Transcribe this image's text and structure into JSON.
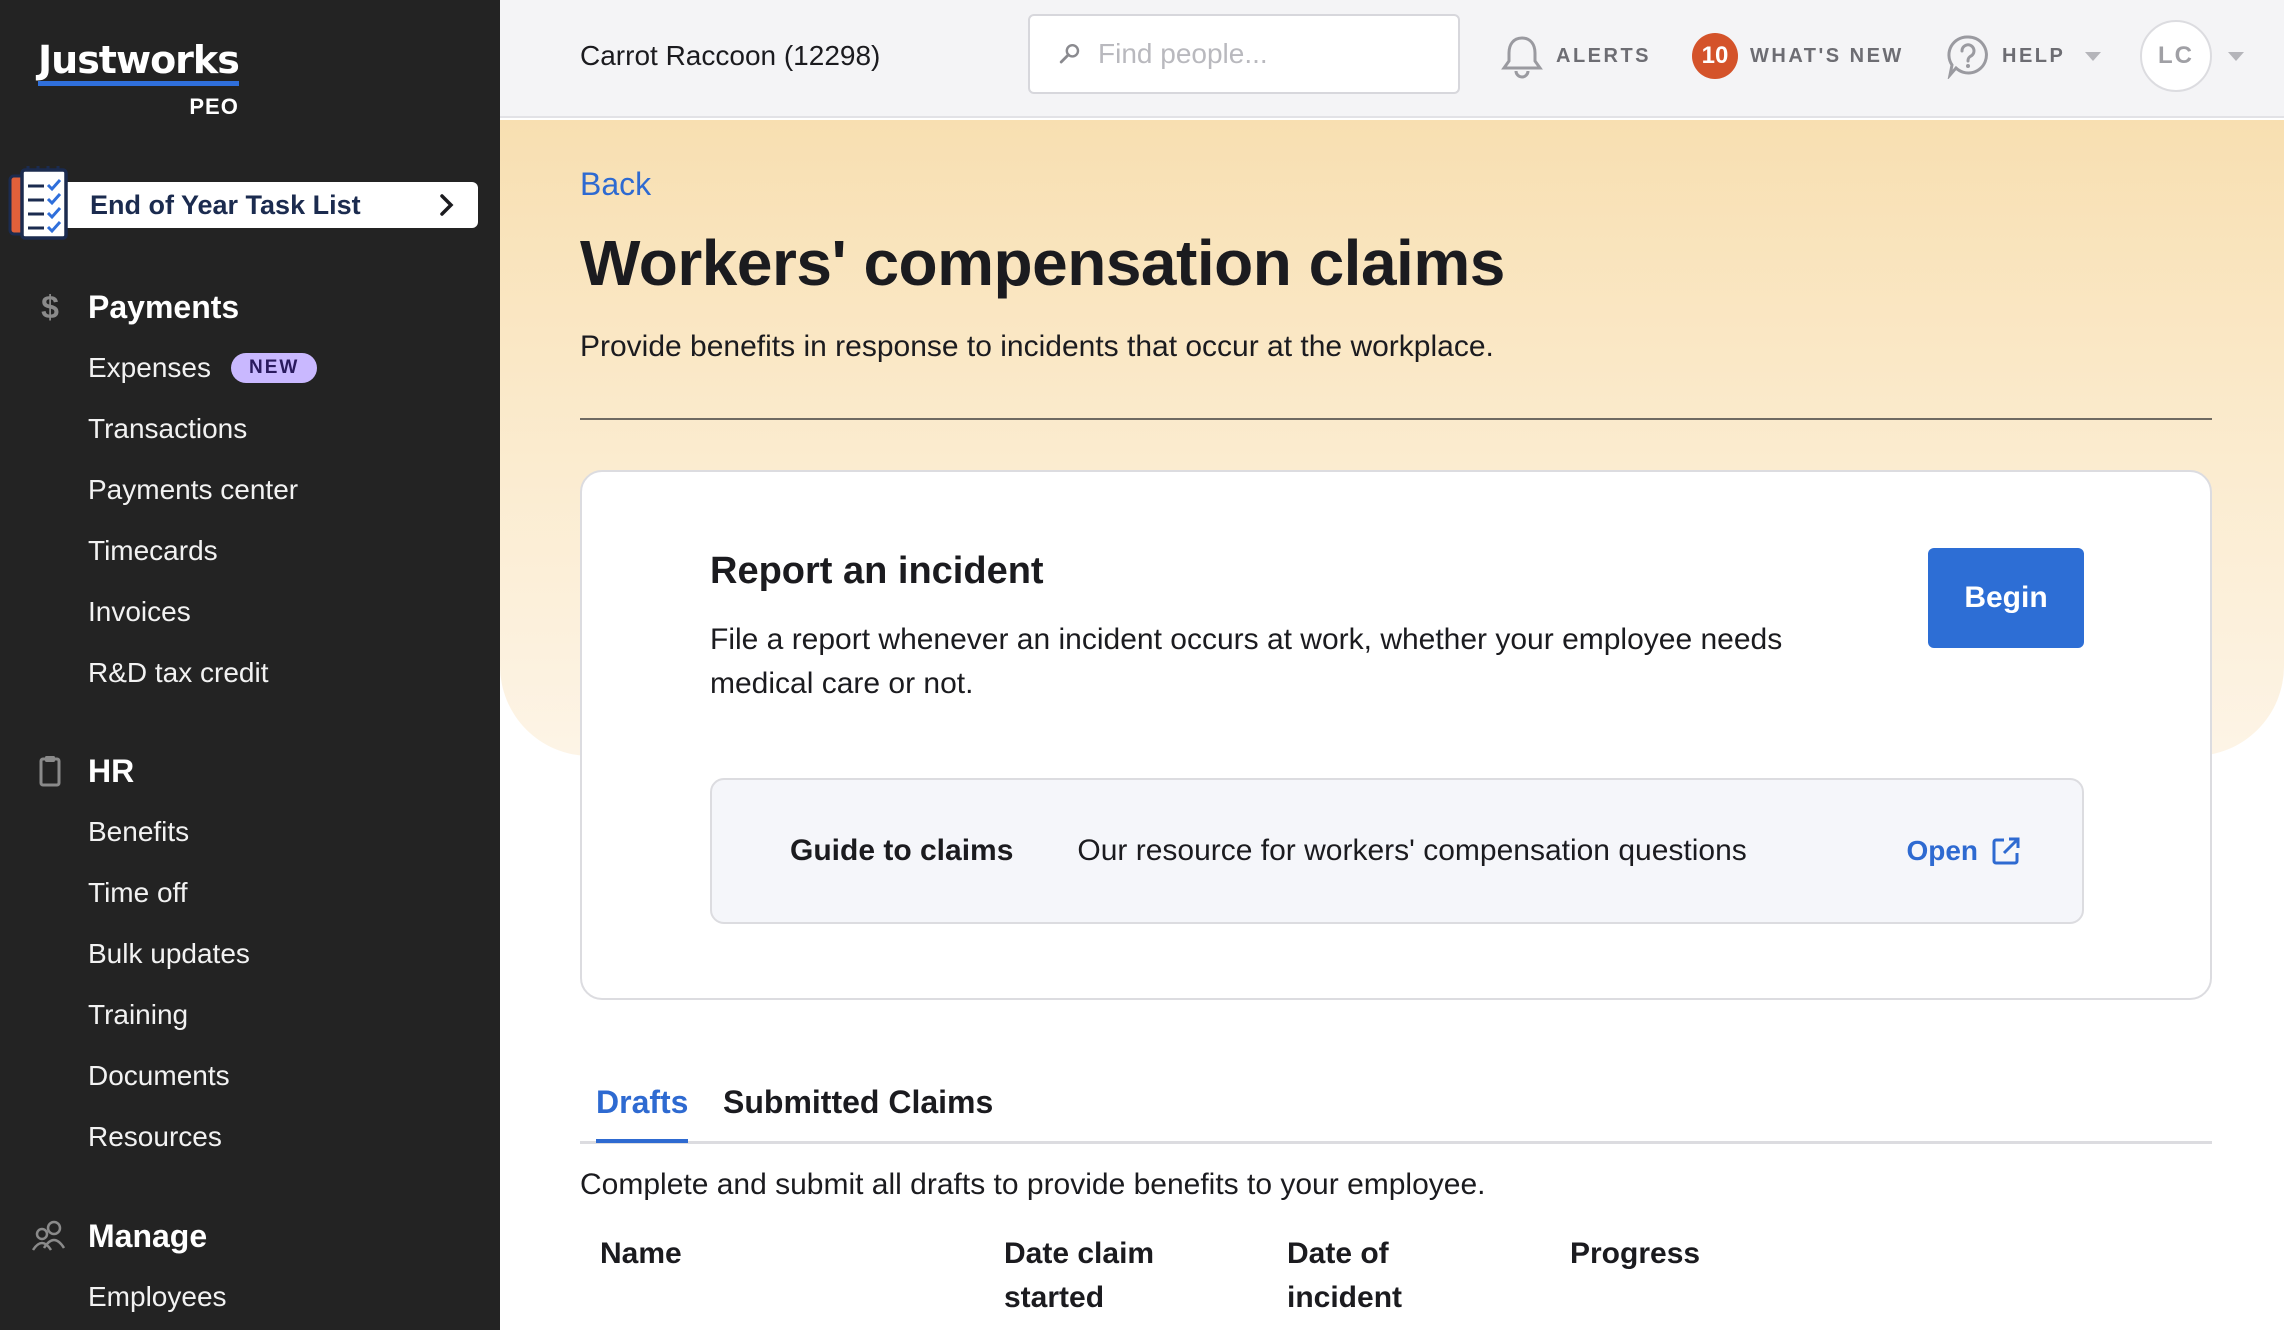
{
  "brand": {
    "name": "Justworks",
    "product": "PEO",
    "accent_color": "#2f6fdb"
  },
  "task_list": {
    "label": "End of Year Task List",
    "icon": "checklist-icon"
  },
  "sidebar": {
    "sections": [
      {
        "label": "Payments",
        "icon": "dollar-icon",
        "items": [
          {
            "label": "Expenses",
            "badge": "NEW"
          },
          {
            "label": "Transactions"
          },
          {
            "label": "Payments center"
          },
          {
            "label": "Timecards"
          },
          {
            "label": "Invoices"
          },
          {
            "label": "R&D tax credit"
          }
        ]
      },
      {
        "label": "HR",
        "icon": "clipboard-icon",
        "items": [
          {
            "label": "Benefits"
          },
          {
            "label": "Time off"
          },
          {
            "label": "Bulk updates"
          },
          {
            "label": "Training"
          },
          {
            "label": "Documents"
          },
          {
            "label": "Resources"
          }
        ]
      },
      {
        "label": "Manage",
        "icon": "people-icon",
        "items": [
          {
            "label": "Employees"
          }
        ]
      }
    ]
  },
  "topbar": {
    "company": "Carrot Raccoon (12298)",
    "search": {
      "placeholder": "Find people...",
      "value": ""
    },
    "alerts_label": "ALERTS",
    "whats_new": {
      "count": "10",
      "label": "WHAT'S NEW",
      "badge_color": "#d4532a"
    },
    "help_label": "HELP",
    "avatar_initials": "LC"
  },
  "main": {
    "back_label": "Back",
    "title": "Workers' compensation claims",
    "subtitle": "Provide benefits in response to incidents that occur at the workplace.",
    "report": {
      "title": "Report an incident",
      "text": "File a report whenever an incident occurs at work, whether your employee needs medical care or not.",
      "button": "Begin"
    },
    "guide": {
      "title": "Guide to claims",
      "text": "Our resource for workers' compensation questions",
      "link": "Open"
    },
    "tabs": [
      {
        "label": "Drafts",
        "active": true
      },
      {
        "label": "Submitted Claims",
        "active": false
      }
    ],
    "drafts_note": "Complete and submit all drafts to provide benefits to your employee.",
    "table": {
      "headers": [
        {
          "line1": "Name",
          "line2": ""
        },
        {
          "line1": "Date claim",
          "line2": "started"
        },
        {
          "line1": "Date of",
          "line2": "incident"
        },
        {
          "line1": "Progress",
          "line2": ""
        }
      ]
    }
  }
}
